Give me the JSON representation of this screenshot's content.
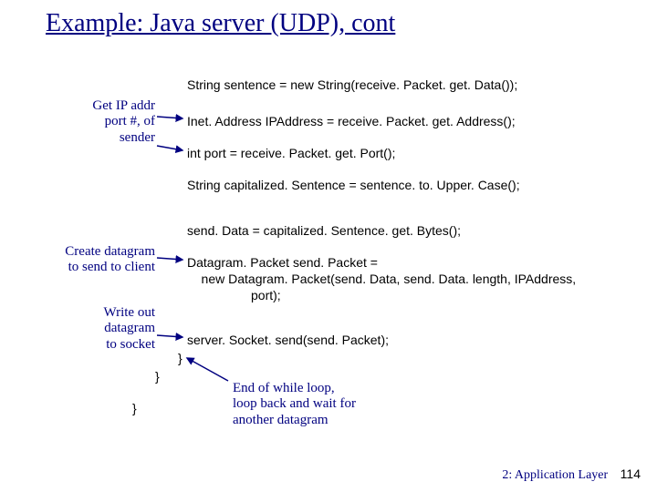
{
  "title": "Example: Java server (UDP), cont",
  "code": {
    "l1": "String sentence = new String(receive. Packet. get. Data());",
    "l2": "Inet. Address IPAddress = receive. Packet. get. Address();",
    "l3": "int port = receive. Packet. get. Port();",
    "l4": "String capitalized. Sentence = sentence. to. Upper. Case();",
    "l5": "send. Data = capitalized. Sentence. get. Bytes();",
    "l6": "Datagram. Packet send. Packet =",
    "l7": "    new Datagram. Packet(send. Data, send. Data. length, IPAddress,",
    "l8": "port);",
    "l9": "server. Socket. send(send. Packet);",
    "l10": "}",
    "l11": "}",
    "l12": "}"
  },
  "anno": {
    "a1_l1": "Get IP addr",
    "a1_l2": "port #, of",
    "a1_l3": "sender",
    "a2_l1": "Create datagram",
    "a2_l2": "to send to client",
    "a3_l1": "Write out",
    "a3_l2": "datagram",
    "a3_l3": "to socket",
    "a4_l1": "End of while loop,",
    "a4_l2": "loop back and wait for",
    "a4_l3": "another datagram"
  },
  "footer": {
    "chapter": "2: Application Layer",
    "page": "114"
  }
}
